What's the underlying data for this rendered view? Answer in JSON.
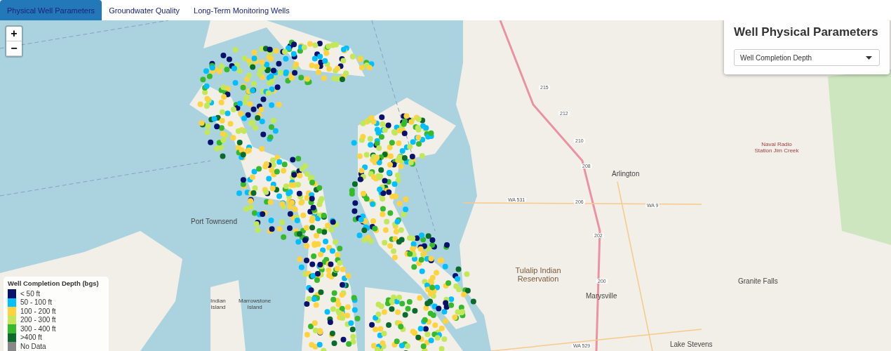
{
  "tabs": [
    {
      "label": "Physical Well Parameters",
      "selected": true
    },
    {
      "label": "Groundwater Quality",
      "selected": false
    },
    {
      "label": "Long-Term Monitoring Wells",
      "selected": false
    }
  ],
  "zoom_controls": [
    "+",
    "−"
  ],
  "panel": {
    "title": "Well Physical Parameters",
    "select_value": "Well Completion Depth"
  },
  "map_labels": [
    {
      "text": "215",
      "kind": "road"
    },
    {
      "text": "212",
      "kind": "road"
    },
    {
      "text": "210",
      "kind": "road"
    },
    {
      "text": "Naval Radio Station Jim Creek",
      "kind": "military"
    },
    {
      "text": "208",
      "kind": "road"
    },
    {
      "text": "Arlington",
      "kind": "place"
    },
    {
      "text": "WA 531",
      "kind": "road"
    },
    {
      "text": "206",
      "kind": "road"
    },
    {
      "text": "WA 9",
      "kind": "road"
    },
    {
      "text": "Port Townsend",
      "kind": "place"
    },
    {
      "text": "202",
      "kind": "road"
    },
    {
      "text": "Tulalip Indian Reservation",
      "kind": "area"
    },
    {
      "text": "200",
      "kind": "road"
    },
    {
      "text": "Granite Falls",
      "kind": "place"
    },
    {
      "text": "Marysville",
      "kind": "place"
    },
    {
      "text": "Indian Island",
      "kind": "island"
    },
    {
      "text": "Marrowstone Island",
      "kind": "island"
    },
    {
      "text": "Lake Stevens",
      "kind": "place"
    },
    {
      "text": "WA 529",
      "kind": "road"
    }
  ],
  "legend": {
    "title": "Well Completion Depth (bgs)",
    "items": [
      {
        "label": "< 50 ft",
        "color": "#08116b"
      },
      {
        "label": "50 - 100 ft",
        "color": "#00bfff"
      },
      {
        "label": "100 - 200 ft",
        "color": "#ffd23f"
      },
      {
        "label": "200 - 300 ft",
        "color": "#c2e85a"
      },
      {
        "label": "300 - 400 ft",
        "color": "#36b92c"
      },
      {
        "label": ">400 ft",
        "color": "#0b6b2a"
      },
      {
        "label": "No Data",
        "color": "#888888"
      }
    ]
  }
}
